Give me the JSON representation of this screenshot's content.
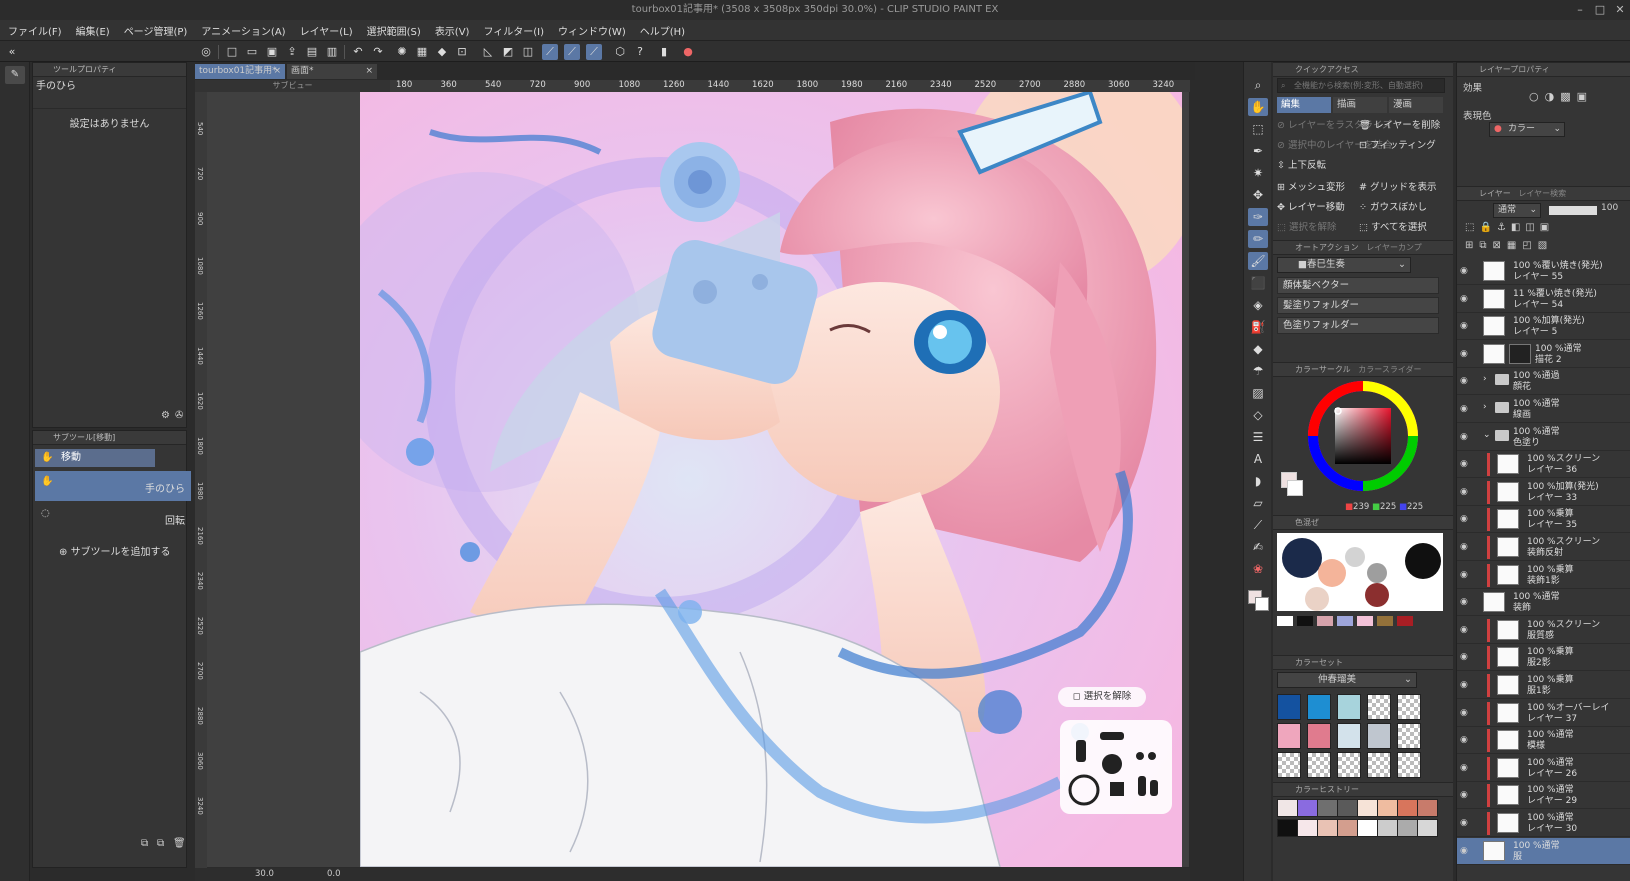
{
  "window": {
    "title": "tourbox01記事用* (3508 x 3508px 350dpi 30.0%) - CLIP STUDIO PAINT EX",
    "minimize": "–",
    "maximize": "□",
    "close": "✕"
  },
  "menu": [
    "ファイル(F)",
    "編集(E)",
    "ページ管理(P)",
    "アニメーション(A)",
    "レイヤー(L)",
    "選択範囲(S)",
    "表示(V)",
    "フィルター(I)",
    "ウィンドウ(W)",
    "ヘルプ(H)"
  ],
  "tool_property": {
    "title": "ツールプロパティ",
    "tool_name": "手のひら",
    "no_settings": "設定はありません"
  },
  "subtool": {
    "title": "サブツール[移動]",
    "group": "移動",
    "items": [
      "手のひら",
      "回転"
    ],
    "add": "サブツールを追加する"
  },
  "doc_tabs": {
    "active": "tourbox01記事用*",
    "second": "画面*",
    "preview": "サブビュー"
  },
  "ruler": {
    "labels": [
      "180",
      "360",
      "540",
      "720",
      "900",
      "1080",
      "1260",
      "1440",
      "1620",
      "1800",
      "1980",
      "2160",
      "2340",
      "2520",
      "2700",
      "2880",
      "3060",
      "3240"
    ]
  },
  "vruler": {
    "labels": [
      "540",
      "720",
      "900",
      "1080",
      "1260",
      "1440",
      "1620",
      "1800",
      "1980",
      "2160",
      "2340",
      "2520",
      "2700",
      "2880",
      "3060",
      "3240"
    ]
  },
  "canvas": {
    "deselect_button": "選択を解除",
    "status_zoom": "30.0",
    "status_angle": "0.0"
  },
  "quick_access": {
    "title": "クイックアクセス",
    "search_placeholder": "全機能から検索(例:変形、自動選択)",
    "tabs": [
      "編集",
      "描画",
      "漫画"
    ],
    "items": [
      {
        "label": "レイヤーをラスタライズ",
        "enabled": false
      },
      {
        "label": "レイヤーを削除",
        "enabled": true
      },
      {
        "label": "選択中のレイヤーを結合",
        "enabled": false
      },
      {
        "label": "フィッティング",
        "enabled": true
      },
      {
        "label": "上下反転",
        "enabled": true
      },
      {
        "label": "",
        "enabled": true
      },
      {
        "label": "メッシュ変形",
        "enabled": true
      },
      {
        "label": "グリッドを表示",
        "enabled": true
      },
      {
        "label": "レイヤー移動",
        "enabled": true
      },
      {
        "label": "ガウスぼかし",
        "enabled": true
      },
      {
        "label": "選択を解除",
        "enabled": false
      },
      {
        "label": "すべてを選択",
        "enabled": true
      }
    ]
  },
  "auto_action": {
    "title": "オートアクション",
    "tab2": "レイヤーカンプ",
    "set": "■春巳生奏",
    "actions": [
      "顔体髪ベクター",
      "髪塗りフォルダー",
      "色塗りフォルダー"
    ]
  },
  "color_circle": {
    "title": "カラーサークル",
    "tab2": "カラースライダー",
    "r": "239",
    "g": "225",
    "b": "225",
    "main": "#efe1e1",
    "sub": "#ffffff"
  },
  "color_mix": {
    "title": "色混ぜ"
  },
  "color_set": {
    "title": "カラーセット",
    "set_name": "仲春瑠美",
    "swatches": [
      "#1452a0",
      "#1e8ed2",
      "#a7d3dc",
      "chk",
      "chk",
      "#efa6bd",
      "#e07b8e",
      "#d3e2eb",
      "#bfc6cf",
      "chk",
      "chk",
      "chk",
      "chk",
      "chk",
      "chk"
    ]
  },
  "color_history": {
    "title": "カラーヒストリー",
    "colors": [
      "#f0e6e6",
      "#8a6be0",
      "#6f6f6f",
      "#5a5a5a",
      "#f6e3d7",
      "#efbca0",
      "#d8755c",
      "#c87b6b",
      "#101010",
      "#f6e7ea",
      "#e9c2b4",
      "#d39e8e",
      "#ffffff",
      "#cccccc",
      "#ababab",
      "#d7d7d7"
    ]
  },
  "layer_property": {
    "title": "レイヤープロパティ",
    "effect": "効果",
    "expression_color": "表現色",
    "color_mode": "カラー"
  },
  "layer": {
    "title": "レイヤー",
    "tab2": "レイヤー検索",
    "blend": "通常",
    "opacity": "100",
    "rows": [
      {
        "t1": "100 %覆い焼き(発光)",
        "t2": "レイヤー 55",
        "type": "layer",
        "clip": false
      },
      {
        "t1": "11 %覆い焼き(発光)",
        "t2": "レイヤー 54",
        "type": "layer",
        "clip": false
      },
      {
        "t1": "100 %加算(発光)",
        "t2": "レイヤー 5",
        "type": "layer",
        "clip": false
      },
      {
        "t1": "100 %通常",
        "t2": "描花 2",
        "type": "mask",
        "clip": false
      },
      {
        "t1": "100 %通過",
        "t2": "顔花",
        "type": "folder",
        "clip": false
      },
      {
        "t1": "100 %通常",
        "t2": "線画",
        "type": "folder",
        "clip": false
      },
      {
        "t1": "100 %通常",
        "t2": "色塗り",
        "type": "folder-open",
        "clip": false
      },
      {
        "t1": "100 %スクリーン",
        "t2": "レイヤー 36",
        "type": "layer",
        "clip": true
      },
      {
        "t1": "100 %加算(発光)",
        "t2": "レイヤー 33",
        "type": "layer",
        "clip": true
      },
      {
        "t1": "100 %乗算",
        "t2": "レイヤー 35",
        "type": "layer",
        "clip": true
      },
      {
        "t1": "100 %スクリーン",
        "t2": "装飾反射",
        "type": "layer",
        "clip": true
      },
      {
        "t1": "100 %乗算",
        "t2": "装飾1影",
        "type": "layer",
        "clip": true
      },
      {
        "t1": "100 %通常",
        "t2": "装飾",
        "type": "layer",
        "clip": false
      },
      {
        "t1": "100 %スクリーン",
        "t2": "服質感",
        "type": "layer",
        "clip": true
      },
      {
        "t1": "100 %乗算",
        "t2": "服2影",
        "type": "layer",
        "clip": true
      },
      {
        "t1": "100 %乗算",
        "t2": "服1影",
        "type": "layer",
        "clip": true
      },
      {
        "t1": "100 %オーバーレイ",
        "t2": "レイヤー 37",
        "type": "layer",
        "clip": true
      },
      {
        "t1": "100 %通常",
        "t2": "模様",
        "type": "layer",
        "clip": true
      },
      {
        "t1": "100 %通常",
        "t2": "レイヤー 26",
        "type": "layer",
        "clip": true
      },
      {
        "t1": "100 %通常",
        "t2": "レイヤー 29",
        "type": "layer",
        "clip": true
      },
      {
        "t1": "100 %通常",
        "t2": "レイヤー 30",
        "type": "layer",
        "clip": true
      },
      {
        "t1": "100 %通常",
        "t2": "服",
        "type": "layer",
        "clip": false,
        "selected": true
      }
    ]
  }
}
